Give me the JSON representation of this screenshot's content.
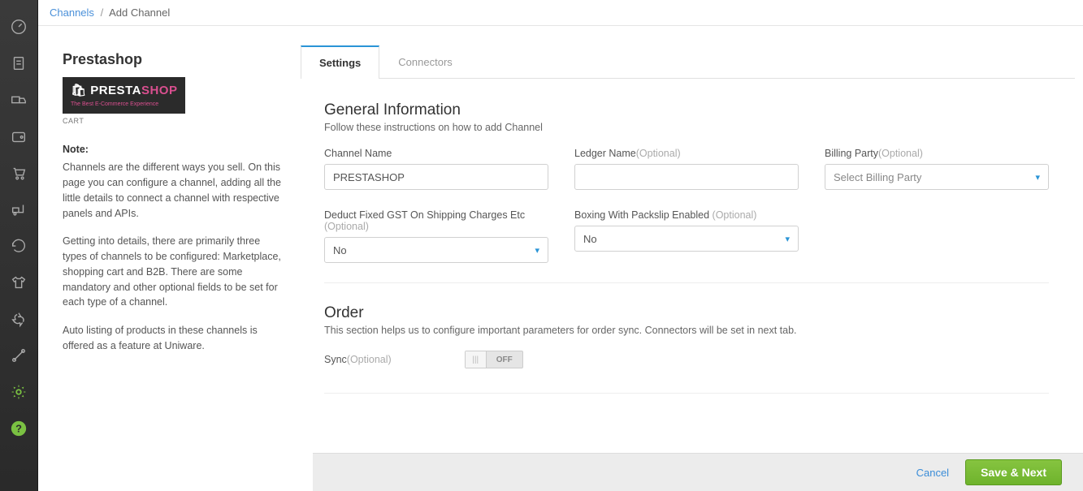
{
  "breadcrumb": {
    "link": "Channels",
    "current": "Add Channel"
  },
  "info": {
    "title": "Prestashop",
    "logo_presta": "PRESTA",
    "logo_shop": "SHOP",
    "logo_tag": "The Best E-Commerce Experience",
    "cart": "CART",
    "note_label": "Note:",
    "p1": "Channels are the different ways you sell. On this page you can configure a channel, adding all the little details to connect a channel with respective panels and APIs.",
    "p2": "Getting into details, there are primarily three types of channels to be configured: Marketplace, shopping cart and B2B. There are some mandatory and other optional fields to be set for each type of a channel.",
    "p3": "Auto listing of products in these channels is offered as a feature at Uniware."
  },
  "tabs": {
    "settings": "Settings",
    "connectors": "Connectors"
  },
  "form": {
    "general_h": "General Information",
    "general_sub": "Follow these instructions on how to add Channel",
    "channel_name_label": "Channel Name",
    "channel_name_value": "PRESTASHOP",
    "ledger_label": "Ledger Name",
    "ledger_opt": "(Optional)",
    "billing_label": "Billing Party",
    "billing_opt": "(Optional)",
    "billing_placeholder": "Select Billing Party",
    "deduct_label": "Deduct Fixed GST On Shipping Charges Etc ",
    "deduct_opt": "(Optional)",
    "deduct_value": "No",
    "boxing_label": "Boxing With Packslip Enabled ",
    "boxing_opt": "(Optional)",
    "boxing_value": "No",
    "order_h": "Order",
    "order_sub": "This section helps us to configure important parameters for order sync. Connectors will be set in next tab.",
    "sync_label": "Sync",
    "sync_opt": "(Optional)",
    "toggle_off": "OFF"
  },
  "footer": {
    "cancel": "Cancel",
    "save": "Save & Next"
  }
}
